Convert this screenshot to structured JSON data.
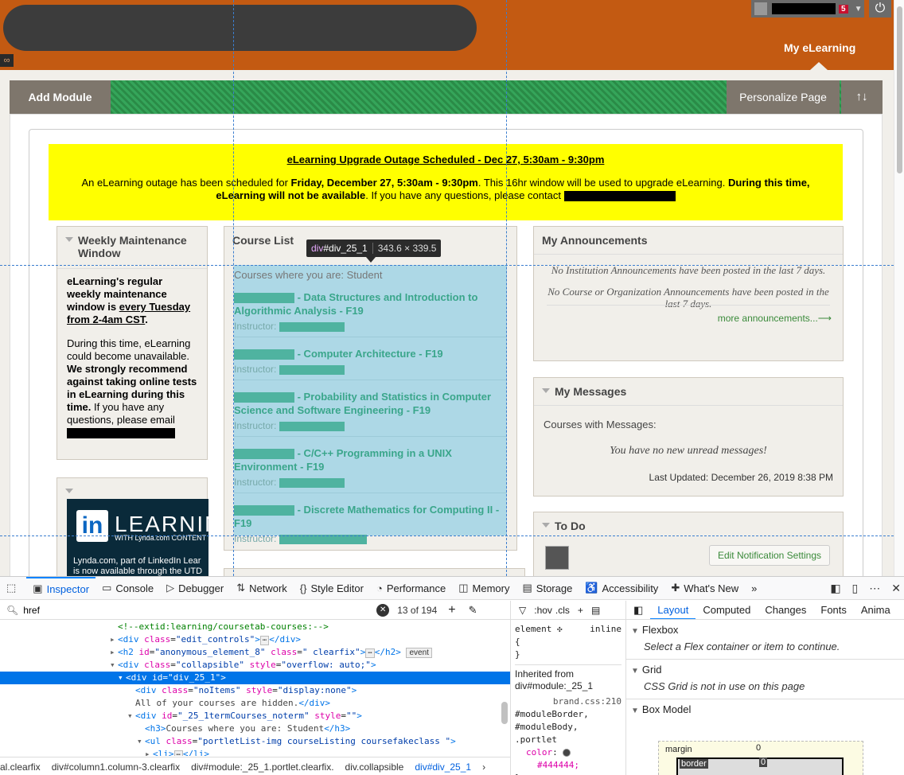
{
  "header": {
    "notification_count": "5",
    "tab_label": "My eLearning"
  },
  "toolbar": {
    "add_module": "Add Module",
    "personalize": "Personalize Page",
    "reorder_icon": "↑↓"
  },
  "outage": {
    "title": "eLearning Upgrade Outage Scheduled - Dec 27, 5:30am - 9:30pm",
    "body_1": "An eLearning outage has been scheduled for ",
    "body_bold_1": "Friday, December 27, 5:30am - 9:30pm",
    "body_2": ". This 16hr window will be used to upgrade eLearning. ",
    "body_bold_2": "During this time, eLearning will not be available",
    "body_3": ".  If you have any questions, please contact "
  },
  "maintenance": {
    "title": "Weekly Maintenance Window",
    "p1_a": "eLearning's regular weekly maintenance window is ",
    "p1_b": "every Tuesday from 2-4am CST",
    "p1_c": ".",
    "p2_a": "During this time, eLearning could become unavailable.",
    "p2_b": " We strongly recommend against taking online tests in eLearning during this time.",
    "p2_c": " If you have any questions, please email"
  },
  "linkedin": {
    "in": "in",
    "word": "LEARNING",
    "sub": "WITH Lynda.com CONTENT",
    "desc_1": "Lynda.com, part of LinkedIn Lear",
    "desc_2": "is now available through the UTD"
  },
  "courses": {
    "title": "Course List",
    "subtitle": "Courses where you are: Student",
    "instructor_label": "Instructor:",
    "items": [
      {
        "name": " - Data Structures and Introduction to Algorithmic Analysis - F19"
      },
      {
        "name": " - Computer Architecture - F19"
      },
      {
        "name": " - Probability and Statistics in Computer Science and Software Engineering - F19"
      },
      {
        "name": " - C/C++ Programming in a UNIX Environment - F19"
      },
      {
        "name": " - Discrete Mathematics for Computing II - F19"
      }
    ]
  },
  "highlight": {
    "selector_tag": "div",
    "selector_id": "#div_25_1",
    "dimensions": "343.6 × 339.5"
  },
  "announcements": {
    "title": "My Announcements",
    "note_1": "No Institution Announcements have been posted in the last 7 days.",
    "note_2": "No Course or Organization Announcements have been posted in the last 7 days.",
    "more": "more announcements..."
  },
  "messages": {
    "title": "My Messages",
    "courses_label": "Courses with Messages:",
    "none": "You have no new unread messages!",
    "updated": "Last Updated: December 26, 2019 8:38 PM"
  },
  "todo": {
    "title": "To Do",
    "edit_button": "Edit Notification Settings"
  },
  "devtools": {
    "tabs": [
      {
        "label": "Inspector",
        "icon": "▣"
      },
      {
        "label": "Console",
        "icon": "▭"
      },
      {
        "label": "Debugger",
        "icon": "▷"
      },
      {
        "label": "Network",
        "icon": "⇅"
      },
      {
        "label": "Style Editor",
        "icon": "{}"
      },
      {
        "label": "Performance",
        "icon": "◔"
      },
      {
        "label": "Memory",
        "icon": "◫"
      },
      {
        "label": "Storage",
        "icon": "▤"
      },
      {
        "label": "Accessibility",
        "icon": "♿"
      },
      {
        "label": "What's New",
        "icon": "✚"
      }
    ],
    "search_value": "href",
    "search_count": "13 of 194",
    "markup": {
      "l1": "<!--extid:learning/coursetab-courses:-->",
      "l2_tag": "div",
      "l2_attr": "class",
      "l2_val": "\"edit_controls\"",
      "l3_attr1": "id",
      "l3_val1": "\"anonymous_element_8\"",
      "l3_attr2": "class",
      "l3_val2": "\" clearfix\"",
      "l3_event": "event",
      "l4_attr1": "class",
      "l4_val1": "\"collapsible\"",
      "l4_attr2": "style",
      "l4_val2": "\"overflow: auto;\"",
      "l5_attr": "id",
      "l5_val": "\"div_25_1\"",
      "l6_attr1": "class",
      "l6_val1": "\"noItems\"",
      "l6_attr2": "style",
      "l6_val2": "\"display:none\"",
      "l7_text": "All of your courses are hidden.",
      "l8_attr1": "id",
      "l8_val1": "\"_25_1termCourses_noterm\"",
      "l8_attr2": "style",
      "l8_val2": "\"\"",
      "l9_text": "Courses where you are: Student",
      "l10_attr": "class",
      "l10_val": "\"portletList-img courseListing coursefakeclass \""
    },
    "breadcrumbs": [
      "al.clearfix",
      "div#column1.column-3.clearfix",
      "div#module:_25_1.portlet.clearfix.",
      "div.collapsible",
      "div#div_25_1"
    ],
    "rules": {
      "filter_hov": ":hov",
      "filter_cls": ".cls",
      "element_rule": "element",
      "element_src": "inline",
      "inherited": "Inherited from div#module:_25_1",
      "src": "brand.css:210",
      "selector": "#moduleBorder, #moduleBody, .portlet",
      "prop": "color",
      "value": "#444444"
    },
    "layout_tabs": [
      "Layout",
      "Computed",
      "Changes",
      "Fonts",
      "Anima"
    ],
    "flexbox_title": "Flexbox",
    "flexbox_msg": "Select a Flex container or item to continue.",
    "grid_title": "Grid",
    "grid_msg": "CSS Grid is not in use on this page",
    "boxmodel_title": "Box Model",
    "bm_margin": "margin",
    "bm_margin_val": "0",
    "bm_border": "border",
    "bm_border_val": "0"
  }
}
